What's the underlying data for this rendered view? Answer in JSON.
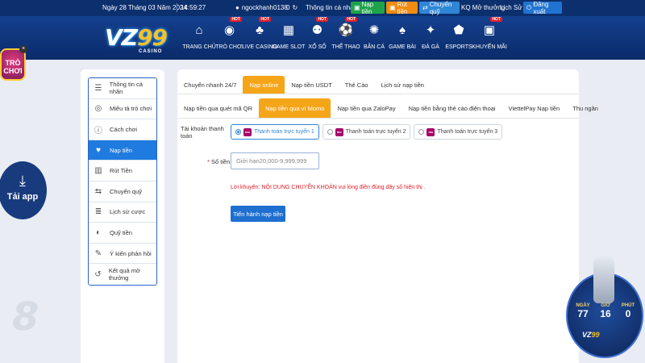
{
  "topbar": {
    "date": "Ngày 28 Tháng 03 Năm 2024",
    "time": "14:59:27",
    "username": "ngockhanh0138",
    "balance": "0",
    "account_info": "Thông tin cá nhân",
    "deposit": "Nạp tiền",
    "withdraw": "Rút tiền",
    "transfer": "Chuyển quỹ",
    "results": "KQ Mở thưởng",
    "history": "Lịch Sử",
    "logout": "Đăng xuất"
  },
  "logo": {
    "main_v": "VZ",
    "main_y": "99",
    "sub": "CASINO"
  },
  "nav": {
    "items": [
      {
        "label": "TRANG CHỦ",
        "icon": "home-icon",
        "hot": ""
      },
      {
        "label": "TRÒ CHƠI",
        "icon": "game-icon",
        "hot": "HOT"
      },
      {
        "label": "LIVE CASINO",
        "icon": "casino-icon",
        "hot": "HOT"
      },
      {
        "label": "GAME SLOT",
        "icon": "slot-icon",
        "hot": ""
      },
      {
        "label": "XỔ SỐ",
        "icon": "lottery-icon",
        "hot": "HOT"
      },
      {
        "label": "THỂ THAO",
        "icon": "sports-icon",
        "hot": "HOT"
      },
      {
        "label": "BẮN CÁ",
        "icon": "fish-icon",
        "hot": ""
      },
      {
        "label": "GAME BÀI",
        "icon": "cards-icon",
        "hot": ""
      },
      {
        "label": "ĐÁ GÀ",
        "icon": "rooster-icon",
        "hot": ""
      },
      {
        "label": "ESPORTS",
        "icon": "esports-icon",
        "hot": ""
      },
      {
        "label": "KHUYẾN MÃI",
        "icon": "gift-icon",
        "hot": "HOT"
      }
    ]
  },
  "floating": {
    "trochoi_line1": "TRÒ",
    "trochoi_line2": "CHƠI",
    "close": "×",
    "taiapp": "Tải app",
    "bg_number": "8"
  },
  "sidebar": {
    "items": [
      {
        "label": "Thông tin cá nhân",
        "icon": "user-card-icon"
      },
      {
        "label": "Miêu tả trò chơi",
        "icon": "gamepad-icon"
      },
      {
        "label": "Cách chơi",
        "icon": "info-icon"
      },
      {
        "label": "Nạp tiền",
        "icon": "piggy-bank-icon"
      },
      {
        "label": "Rút Tiền",
        "icon": "withdraw-icon"
      },
      {
        "label": "Chuyển quỹ",
        "icon": "transfer-icon"
      },
      {
        "label": "Lịch sử cược",
        "icon": "list-icon"
      },
      {
        "label": "Quỹ tiền",
        "icon": "coins-icon"
      },
      {
        "label": "Ý kiến phản hồi",
        "icon": "feedback-icon"
      },
      {
        "label": "Kết quả mở thưởng",
        "icon": "history-icon"
      }
    ],
    "active_index": 3
  },
  "tabs_primary": [
    "Chuyển nhanh 24/7",
    "Nạp online",
    "Nạp tiền USDT",
    "Thẻ Cào",
    "Lịch sử nạp tiền"
  ],
  "tabs_primary_active": 1,
  "tabs_secondary": [
    "Nạp tiền qua quét mã QR",
    "Nạp tiền qua ví Momo",
    "Nạp tiền qua ZaloPay",
    "Nạp tiền bằng thẻ cào điện thoại",
    "ViettelPay Nạp tiền",
    "Thu ngân"
  ],
  "tabs_secondary_active": 1,
  "form": {
    "account_label": "Tài khoản thanh toán",
    "options": [
      "Thanh toán trực tuyến 1",
      "Thanh toán trực tuyến 2",
      "Thanh toán trực tuyến 3"
    ],
    "selected_option": 0,
    "momo_mark": "mo mo",
    "amount_label": "Số tiền",
    "amount_required": "*",
    "amount_placeholder": "Giới hạn20,000-9,999,999",
    "note": "Lời khuyên:  NỘI DUNG CHUYỂN KHOẢN vui lòng điền đúng dãy số hiện thị .",
    "submit": "Tiến hành nạp tiền"
  },
  "euro_badge": {
    "days_label": "NGÀY",
    "days": "77",
    "hours_label": "GIỜ",
    "hours": "16",
    "minutes_label": "PHÚT",
    "minutes": "0",
    "brand_v": "VZ",
    "brand_y": "99"
  },
  "colors": {
    "topbar": "#0c2f6e",
    "active_tab": "#f5a518",
    "primary": "#1f6fd1",
    "warning_text": "#e0202a"
  }
}
